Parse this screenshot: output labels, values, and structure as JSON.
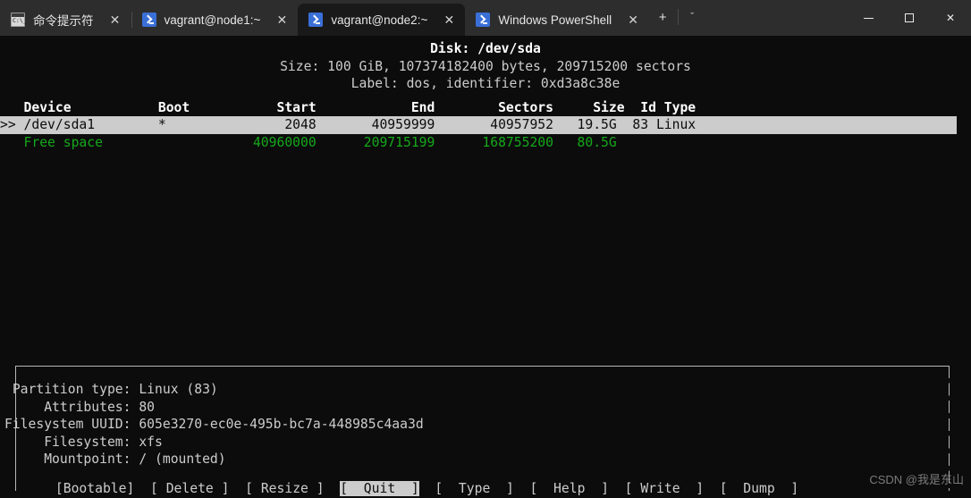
{
  "window": {
    "tabs": [
      {
        "label": "命令提示符",
        "icon": "cmd-icon",
        "active": false
      },
      {
        "label": "vagrant@node1:~",
        "icon": "powershell-icon",
        "active": false
      },
      {
        "label": "vagrant@node2:~",
        "icon": "powershell-icon",
        "active": true
      },
      {
        "label": "Windows PowerShell",
        "icon": "powershell-icon",
        "active": false
      }
    ],
    "close_glyph": "✕",
    "new_tab_glyph": "+",
    "tab_menu_glyph": "ˇ",
    "controls": {
      "minimize": "minimize-icon",
      "maximize": "maximize-icon",
      "close": "close-icon",
      "close_glyph": "✕"
    }
  },
  "disk": {
    "title": "Disk: /dev/sda",
    "size_line": "Size: 100 GiB, 107374182400 bytes, 209715200 sectors",
    "label_line": "Label: dos, identifier: 0xd3a8c38e"
  },
  "table": {
    "header": "   Device           Boot           Start            End        Sectors     Size  Id Type",
    "rows": [
      {
        "selected": true,
        "marker": ">>",
        "text": " /dev/sda1        *               2048       40959999       40957952   19.5G  83 Linux"
      },
      {
        "selected": false,
        "marker": "  ",
        "text": " Free space                   40960000      209715199      168755200   80.5G",
        "color": "green"
      }
    ],
    "columns": [
      "Device",
      "Boot",
      "Start",
      "End",
      "Sectors",
      "Size",
      "Id Type"
    ],
    "partition": {
      "device": "/dev/sda1",
      "boot": "*",
      "start": "2048",
      "end": "40959999",
      "sectors": "40957952",
      "size": "19.5G",
      "id": "83",
      "type": "Linux"
    },
    "free_space": {
      "device": "Free space",
      "start": "40960000",
      "end": "209715199",
      "sectors": "168755200",
      "size": "80.5G"
    }
  },
  "details": {
    "lines": [
      " Partition type: Linux (83)",
      "     Attributes: 80",
      "Filesystem UUID: 605e3270-ec0e-495b-bc7a-448985c4aa3d",
      "     Filesystem: xfs",
      "     Mountpoint: / (mounted)"
    ],
    "partition_type": "Linux (83)",
    "attributes": "80",
    "filesystem_uuid": "605e3270-ec0e-495b-bc7a-448985c4aa3d",
    "filesystem": "xfs",
    "mountpoint": "/ (mounted)"
  },
  "menu": {
    "prefix": "       ",
    "buttons": [
      {
        "label": "[Bootable]",
        "selected": false
      },
      {
        "label": "[ Delete ]",
        "selected": false
      },
      {
        "label": "[ Resize ]",
        "selected": false
      },
      {
        "label": "[  Quit  ]",
        "selected": true
      },
      {
        "label": "[  Type  ]",
        "selected": false
      },
      {
        "label": "[  Help  ]",
        "selected": false
      },
      {
        "label": "[ Write  ]",
        "selected": false
      },
      {
        "label": "[  Dump  ]",
        "selected": false
      }
    ],
    "gap": "  "
  },
  "watermark": "CSDN @我是东山",
  "colors": {
    "terminal_bg": "#0c0c0c",
    "terminal_fg": "#cccccc",
    "highlight_bg": "#cccccc",
    "free_space_fg": "#16a81b",
    "titlebar_bg": "#2d2d2d",
    "active_tab_bg": "#191919",
    "accent": "#3a6fd8"
  }
}
